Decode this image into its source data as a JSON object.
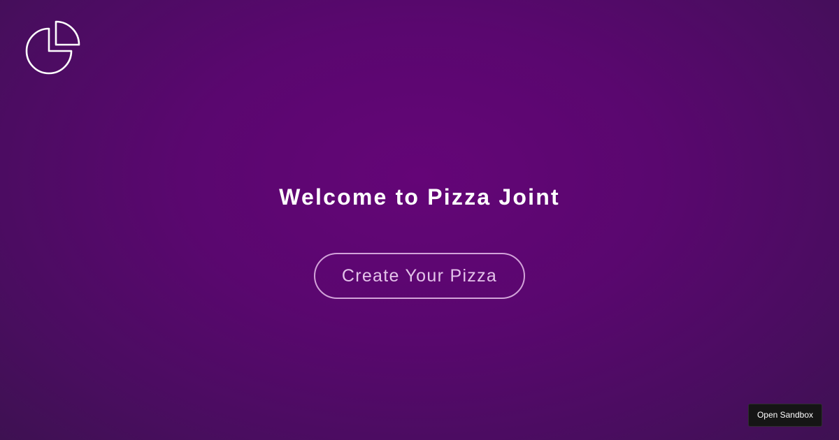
{
  "brand": {
    "logo_icon": "pie-chart-icon",
    "logo_color": "#ffffff"
  },
  "hero": {
    "title": "Welcome to Pizza Joint",
    "cta_label": "Create Your Pizza"
  },
  "footer": {
    "sandbox_label": "Open Sandbox"
  },
  "colors": {
    "background_center": "#640577",
    "background_edge": "#3e1152",
    "cta_text": "#e4c3ea",
    "sandbox_bg": "#151515"
  }
}
